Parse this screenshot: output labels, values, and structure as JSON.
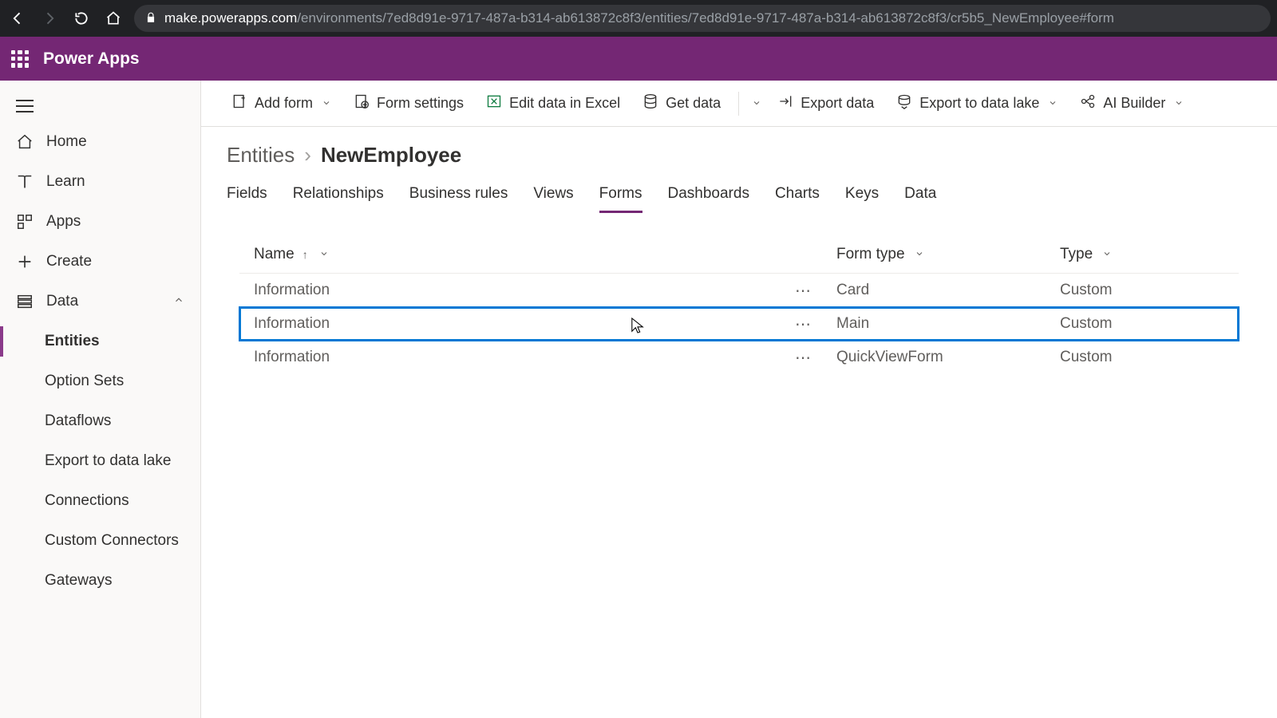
{
  "browser": {
    "url_host": "make.powerapps.com",
    "url_path": "/environments/7ed8d91e-9717-487a-b314-ab613872c8f3/entities/7ed8d91e-9717-487a-b314-ab613872c8f3/cr5b5_NewEmployee#form"
  },
  "app": {
    "title": "Power Apps"
  },
  "sidebar": {
    "items": [
      {
        "label": "Home"
      },
      {
        "label": "Learn"
      },
      {
        "label": "Apps"
      },
      {
        "label": "Create"
      },
      {
        "label": "Data"
      }
    ],
    "data_children": [
      {
        "label": "Entities"
      },
      {
        "label": "Option Sets"
      },
      {
        "label": "Dataflows"
      },
      {
        "label": "Export to data lake"
      },
      {
        "label": "Connections"
      },
      {
        "label": "Custom Connectors"
      },
      {
        "label": "Gateways"
      }
    ]
  },
  "commands": {
    "add_form": "Add form",
    "form_settings": "Form settings",
    "edit_excel": "Edit data in Excel",
    "get_data": "Get data",
    "export_data": "Export data",
    "export_lake": "Export to data lake",
    "ai_builder": "AI Builder"
  },
  "breadcrumb": {
    "root": "Entities",
    "current": "NewEmployee"
  },
  "tabs": [
    "Fields",
    "Relationships",
    "Business rules",
    "Views",
    "Forms",
    "Dashboards",
    "Charts",
    "Keys",
    "Data"
  ],
  "active_tab": "Forms",
  "columns": {
    "name": "Name",
    "form_type": "Form type",
    "type": "Type"
  },
  "rows": [
    {
      "name": "Information",
      "form_type": "Card",
      "type": "Custom"
    },
    {
      "name": "Information",
      "form_type": "Main",
      "type": "Custom"
    },
    {
      "name": "Information",
      "form_type": "QuickViewForm",
      "type": "Custom"
    }
  ]
}
